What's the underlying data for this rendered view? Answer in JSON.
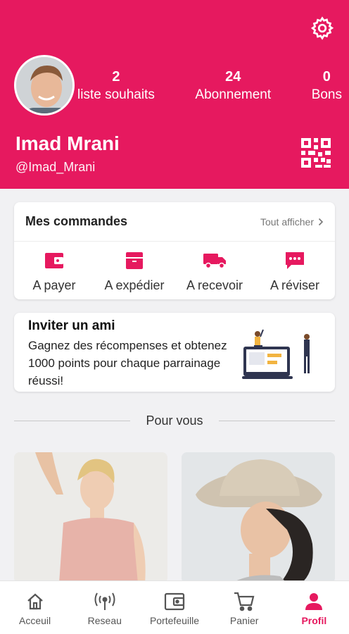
{
  "profile": {
    "name": "Imad Mrani",
    "handle": "@Imad_Mrani",
    "stats": [
      {
        "value": "2",
        "label": "liste souhaits"
      },
      {
        "value": "24",
        "label": "Abonnement"
      },
      {
        "value": "0",
        "label": "Bons"
      }
    ]
  },
  "orders": {
    "title": "Mes commandes",
    "see_all": "Tout afficher",
    "items": [
      {
        "label": "A payer",
        "icon": "wallet-icon"
      },
      {
        "label": "A expédier",
        "icon": "box-icon"
      },
      {
        "label": "A recevoir",
        "icon": "truck-icon"
      },
      {
        "label": "A réviser",
        "icon": "chat-icon"
      }
    ]
  },
  "invite": {
    "title": "Inviter un ami",
    "text": "Gagnez des récompenses et obtenez 1000 points pour chaque parrainage réussi!"
  },
  "section": {
    "title": "Pour vous"
  },
  "nav": {
    "items": [
      {
        "label": "Acceuil",
        "icon": "home-icon"
      },
      {
        "label": "Reseau",
        "icon": "antenna-icon"
      },
      {
        "label": "Portefeuille",
        "icon": "wallet-icon"
      },
      {
        "label": "Panier",
        "icon": "cart-icon"
      },
      {
        "label": "Profil",
        "icon": "person-icon"
      }
    ],
    "active": "Profil"
  },
  "colors": {
    "brand": "#e6195f",
    "background": "#f1f1f3"
  }
}
